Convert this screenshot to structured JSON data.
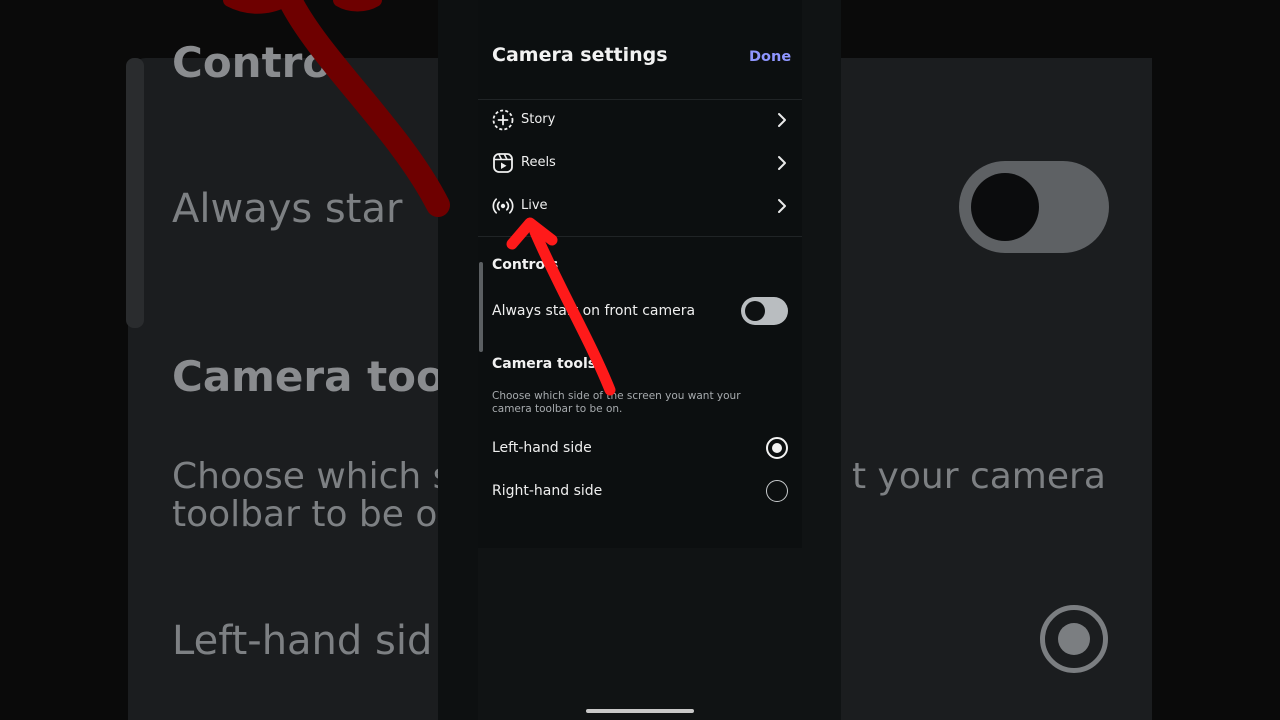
{
  "background": {
    "heading_controls": "Contro",
    "always_start": "Always star",
    "camera_tools": "Camera tools",
    "hint_line1_left": "Choose which sid",
    "hint_line1_right": "t your camera",
    "hint_line2": "toolbar to be on.",
    "left_hand": "Left-hand sid"
  },
  "header": {
    "title": "Camera settings",
    "done_label": "Done"
  },
  "menu": {
    "items": [
      {
        "label": "Story",
        "icon": "story-add-icon"
      },
      {
        "label": "Reels",
        "icon": "reels-icon"
      },
      {
        "label": "Live",
        "icon": "live-broadcast-icon"
      }
    ]
  },
  "controls": {
    "heading": "Controls",
    "front_camera_label": "Always start on front camera",
    "front_camera_enabled": false
  },
  "camera_tools": {
    "heading": "Camera tools",
    "hint": "Choose which side of the screen you want your camera toolbar to be on.",
    "options": [
      {
        "label": "Left-hand side",
        "selected": true
      },
      {
        "label": "Right-hand side",
        "selected": false
      }
    ]
  },
  "colors": {
    "accent": "#8f96ff",
    "annotation_arrow": "#ff1a1a",
    "panel_bg": "#0c0f10"
  }
}
